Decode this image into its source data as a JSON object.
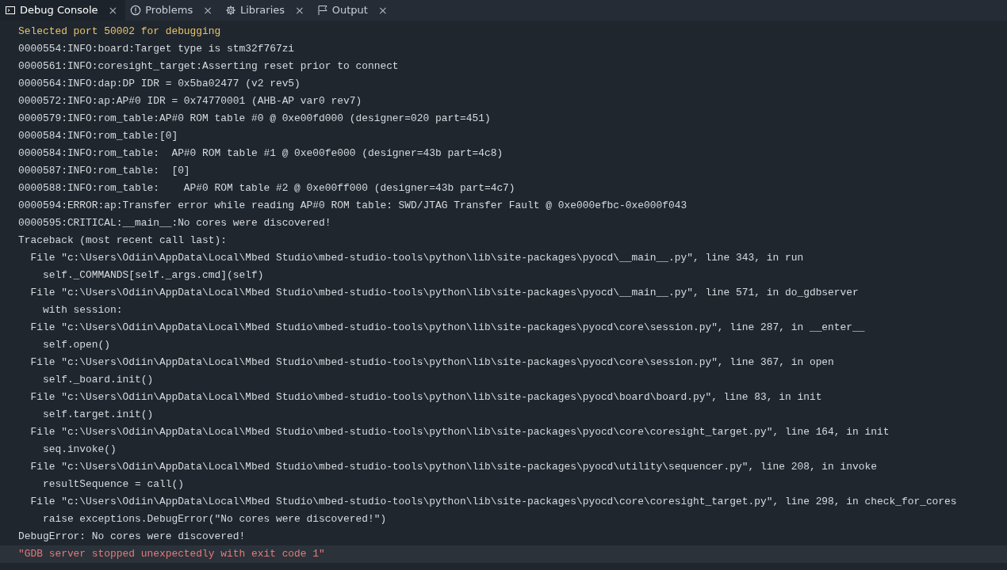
{
  "tabs": [
    {
      "label": "Debug Console",
      "kind": "terminal",
      "close": "×",
      "selected": true
    },
    {
      "label": "Problems",
      "kind": "info",
      "close": "×",
      "selected": false
    },
    {
      "label": "Libraries",
      "kind": "gear",
      "close": "×",
      "selected": false
    },
    {
      "label": "Output",
      "kind": "flag",
      "close": "×",
      "selected": false
    }
  ],
  "console_lines": [
    {
      "text": "Selected port 50002 for debugging",
      "kind": "warning",
      "selected": false
    },
    {
      "text": "0000554:INFO:board:Target type is stm32f767zi",
      "kind": "normal",
      "selected": false
    },
    {
      "text": "0000561:INFO:coresight_target:Asserting reset prior to connect",
      "kind": "normal",
      "selected": false
    },
    {
      "text": "0000564:INFO:dap:DP IDR = 0x5ba02477 (v2 rev5)",
      "kind": "normal",
      "selected": false
    },
    {
      "text": "0000572:INFO:ap:AP#0 IDR = 0x74770001 (AHB-AP var0 rev7)",
      "kind": "normal",
      "selected": false
    },
    {
      "text": "0000579:INFO:rom_table:AP#0 ROM table #0 @ 0xe00fd000 (designer=020 part=451)",
      "kind": "normal",
      "selected": false
    },
    {
      "text": "0000584:INFO:rom_table:[0]",
      "kind": "normal",
      "selected": false
    },
    {
      "text": "0000584:INFO:rom_table:  AP#0 ROM table #1 @ 0xe00fe000 (designer=43b part=4c8)",
      "kind": "normal",
      "selected": false
    },
    {
      "text": "0000587:INFO:rom_table:  [0]",
      "kind": "normal",
      "selected": false
    },
    {
      "text": "0000588:INFO:rom_table:    AP#0 ROM table #2 @ 0xe00ff000 (designer=43b part=4c7)",
      "kind": "normal",
      "selected": false
    },
    {
      "text": "0000594:ERROR:ap:Transfer error while reading AP#0 ROM table: SWD/JTAG Transfer Fault @ 0xe000efbc-0xe000f043",
      "kind": "normal",
      "selected": false
    },
    {
      "text": "0000595:CRITICAL:__main__:No cores were discovered!",
      "kind": "normal",
      "selected": false
    },
    {
      "text": "Traceback (most recent call last):",
      "kind": "normal",
      "selected": false
    },
    {
      "text": "  File \"c:\\Users\\Odiin\\AppData\\Local\\Mbed Studio\\mbed-studio-tools\\python\\lib\\site-packages\\pyocd\\__main__.py\", line 343, in run",
      "kind": "normal",
      "selected": false
    },
    {
      "text": "    self._COMMANDS[self._args.cmd](self)",
      "kind": "normal",
      "selected": false
    },
    {
      "text": "  File \"c:\\Users\\Odiin\\AppData\\Local\\Mbed Studio\\mbed-studio-tools\\python\\lib\\site-packages\\pyocd\\__main__.py\", line 571, in do_gdbserver",
      "kind": "normal",
      "selected": false
    },
    {
      "text": "    with session:",
      "kind": "normal",
      "selected": false
    },
    {
      "text": "  File \"c:\\Users\\Odiin\\AppData\\Local\\Mbed Studio\\mbed-studio-tools\\python\\lib\\site-packages\\pyocd\\core\\session.py\", line 287, in __enter__",
      "kind": "normal",
      "selected": false
    },
    {
      "text": "    self.open()",
      "kind": "normal",
      "selected": false
    },
    {
      "text": "  File \"c:\\Users\\Odiin\\AppData\\Local\\Mbed Studio\\mbed-studio-tools\\python\\lib\\site-packages\\pyocd\\core\\session.py\", line 367, in open",
      "kind": "normal",
      "selected": false
    },
    {
      "text": "    self._board.init()",
      "kind": "normal",
      "selected": false
    },
    {
      "text": "  File \"c:\\Users\\Odiin\\AppData\\Local\\Mbed Studio\\mbed-studio-tools\\python\\lib\\site-packages\\pyocd\\board\\board.py\", line 83, in init",
      "kind": "normal",
      "selected": false
    },
    {
      "text": "    self.target.init()",
      "kind": "normal",
      "selected": false
    },
    {
      "text": "  File \"c:\\Users\\Odiin\\AppData\\Local\\Mbed Studio\\mbed-studio-tools\\python\\lib\\site-packages\\pyocd\\core\\coresight_target.py\", line 164, in init",
      "kind": "normal",
      "selected": false
    },
    {
      "text": "    seq.invoke()",
      "kind": "normal",
      "selected": false
    },
    {
      "text": "  File \"c:\\Users\\Odiin\\AppData\\Local\\Mbed Studio\\mbed-studio-tools\\python\\lib\\site-packages\\pyocd\\utility\\sequencer.py\", line 208, in invoke",
      "kind": "normal",
      "selected": false
    },
    {
      "text": "    resultSequence = call()",
      "kind": "normal",
      "selected": false
    },
    {
      "text": "  File \"c:\\Users\\Odiin\\AppData\\Local\\Mbed Studio\\mbed-studio-tools\\python\\lib\\site-packages\\pyocd\\core\\coresight_target.py\", line 298, in check_for_cores",
      "kind": "normal",
      "selected": false
    },
    {
      "text": "    raise exceptions.DebugError(\"No cores were discovered!\")",
      "kind": "normal",
      "selected": false
    },
    {
      "text": "DebugError: No cores were discovered!",
      "kind": "normal",
      "selected": false
    },
    {
      "text": "\"GDB server stopped unexpectedly with exit code 1\"",
      "kind": "error",
      "selected": true
    }
  ]
}
